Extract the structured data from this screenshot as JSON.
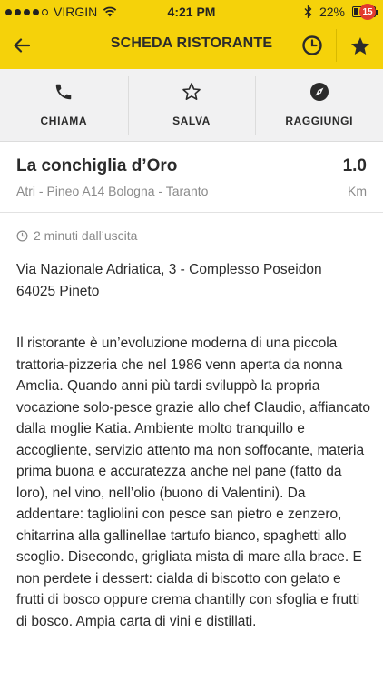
{
  "status_bar": {
    "carrier": "VIRGIN",
    "time": "4:21 PM",
    "battery": "22%",
    "battery_level": 0.22,
    "signal_bars": 4
  },
  "nav": {
    "title": "SCHEDA RISTORANTE",
    "favorites_badge": "15",
    "accent_color": "#f5d20a",
    "badge_color": "#e23b2e"
  },
  "actions": [
    {
      "label": "CHIAMA",
      "icon": "phone-icon"
    },
    {
      "label": "SALVA",
      "icon": "star-outline-icon"
    },
    {
      "label": "RAGGIUNGI",
      "icon": "compass-icon"
    }
  ],
  "restaurant": {
    "name": "La conchiglia d’Oro",
    "route": "Atri - Pineo A14 Bologna - Taranto",
    "distance": "1.0",
    "distance_unit": "Km"
  },
  "address": {
    "time_from_exit": "2 minuti dall’uscita",
    "street": "Via Nazionale Adriatica, 3 - Complesso Poseidon",
    "city": "64025 Pineto"
  },
  "description": "Il ristorante è un’evoluzione moderna di una piccola trattoria-pizzeria che nel 1986 venn aperta da nonna Amelia. Quando anni più tardi sviluppò la propria vocazione solo-pesce grazie allo chef Claudio, affiancato dalla moglie Katia. Ambiente molto tranquillo e accogliente, servizio attento ma non soffocante, materia prima buona e accuratezza anche nel pane (fatto da loro), nel vino, nell’olio (buono di Valentini). Da addentare: tagliolini con pesce san pietro e zenzero, chitarrina alla gallinellae tartufo bianco, spaghetti allo scoglio. Disecondo, grigliata mista di mare alla brace. E non perdete i dessert: cialda di biscotto con gelato e frutti di bosco oppure crema chantilly con sfoglia e frutti di bosco. Ampia carta di vini e distillati."
}
